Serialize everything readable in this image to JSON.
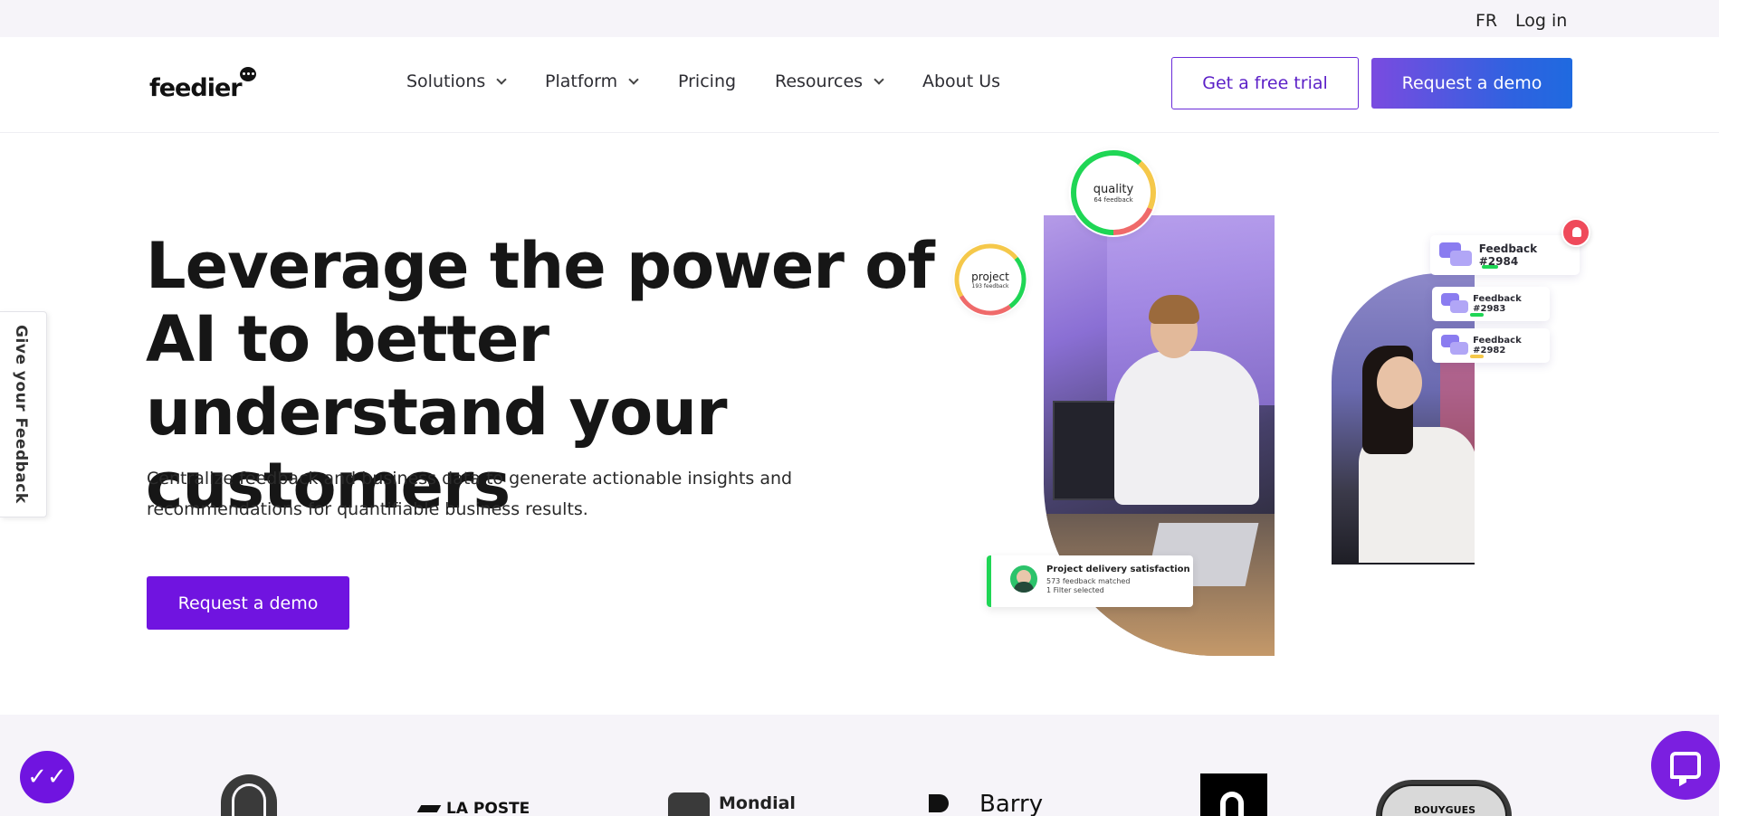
{
  "topbar": {
    "lang": "FR",
    "login": "Log in"
  },
  "header": {
    "logo": "feedier",
    "nav": [
      {
        "label": "Solutions",
        "dropdown": true
      },
      {
        "label": "Platform",
        "dropdown": true
      },
      {
        "label": "Pricing",
        "dropdown": false
      },
      {
        "label": "Resources",
        "dropdown": true
      },
      {
        "label": "About Us",
        "dropdown": false
      }
    ],
    "trial_label": "Get a free trial",
    "demo_label": "Request a demo"
  },
  "hero": {
    "title": "Leverage the power of AI to better understand your customers",
    "subtitle": "Centralize feedback and business data to generate actionable insights and recommendations for quantifiable business results.",
    "cta_label": "Request a demo"
  },
  "feedback_tab": {
    "label": "Give your Feedback"
  },
  "illustration": {
    "quality": {
      "label": "quality",
      "sub": "64 feedback"
    },
    "project": {
      "label": "project",
      "sub": "193 feedback"
    },
    "feedback_cards": [
      {
        "label": "Feedback #2984",
        "tag_color": "#1fd655"
      },
      {
        "label": "Feedback #2983",
        "tag_color": "#1fd655"
      },
      {
        "label": "Feedback #2982",
        "tag_color": "#f5c84a"
      }
    ],
    "project_card": {
      "title": "Project delivery satisfaction",
      "line1": "573 feedback matched",
      "line2": "1 Filter selected"
    }
  },
  "logos": {
    "items": [
      {
        "name": "emblem-logo",
        "text": ""
      },
      {
        "name": "la-poste-logo",
        "text": "LA POSTE"
      },
      {
        "name": "mondial-relay-logo",
        "text": "Mondial"
      },
      {
        "name": "barry-logo",
        "text": "Barry"
      },
      {
        "name": "deezer-logo",
        "text": ""
      },
      {
        "name": "bouygues-logo",
        "text": "BOUYGUES"
      }
    ]
  },
  "colors": {
    "brand": "#7014e0",
    "accent_blue": "#1f6ae0",
    "success": "#1fd655",
    "warning": "#f5c84a",
    "alert": "#ef4a5a"
  }
}
